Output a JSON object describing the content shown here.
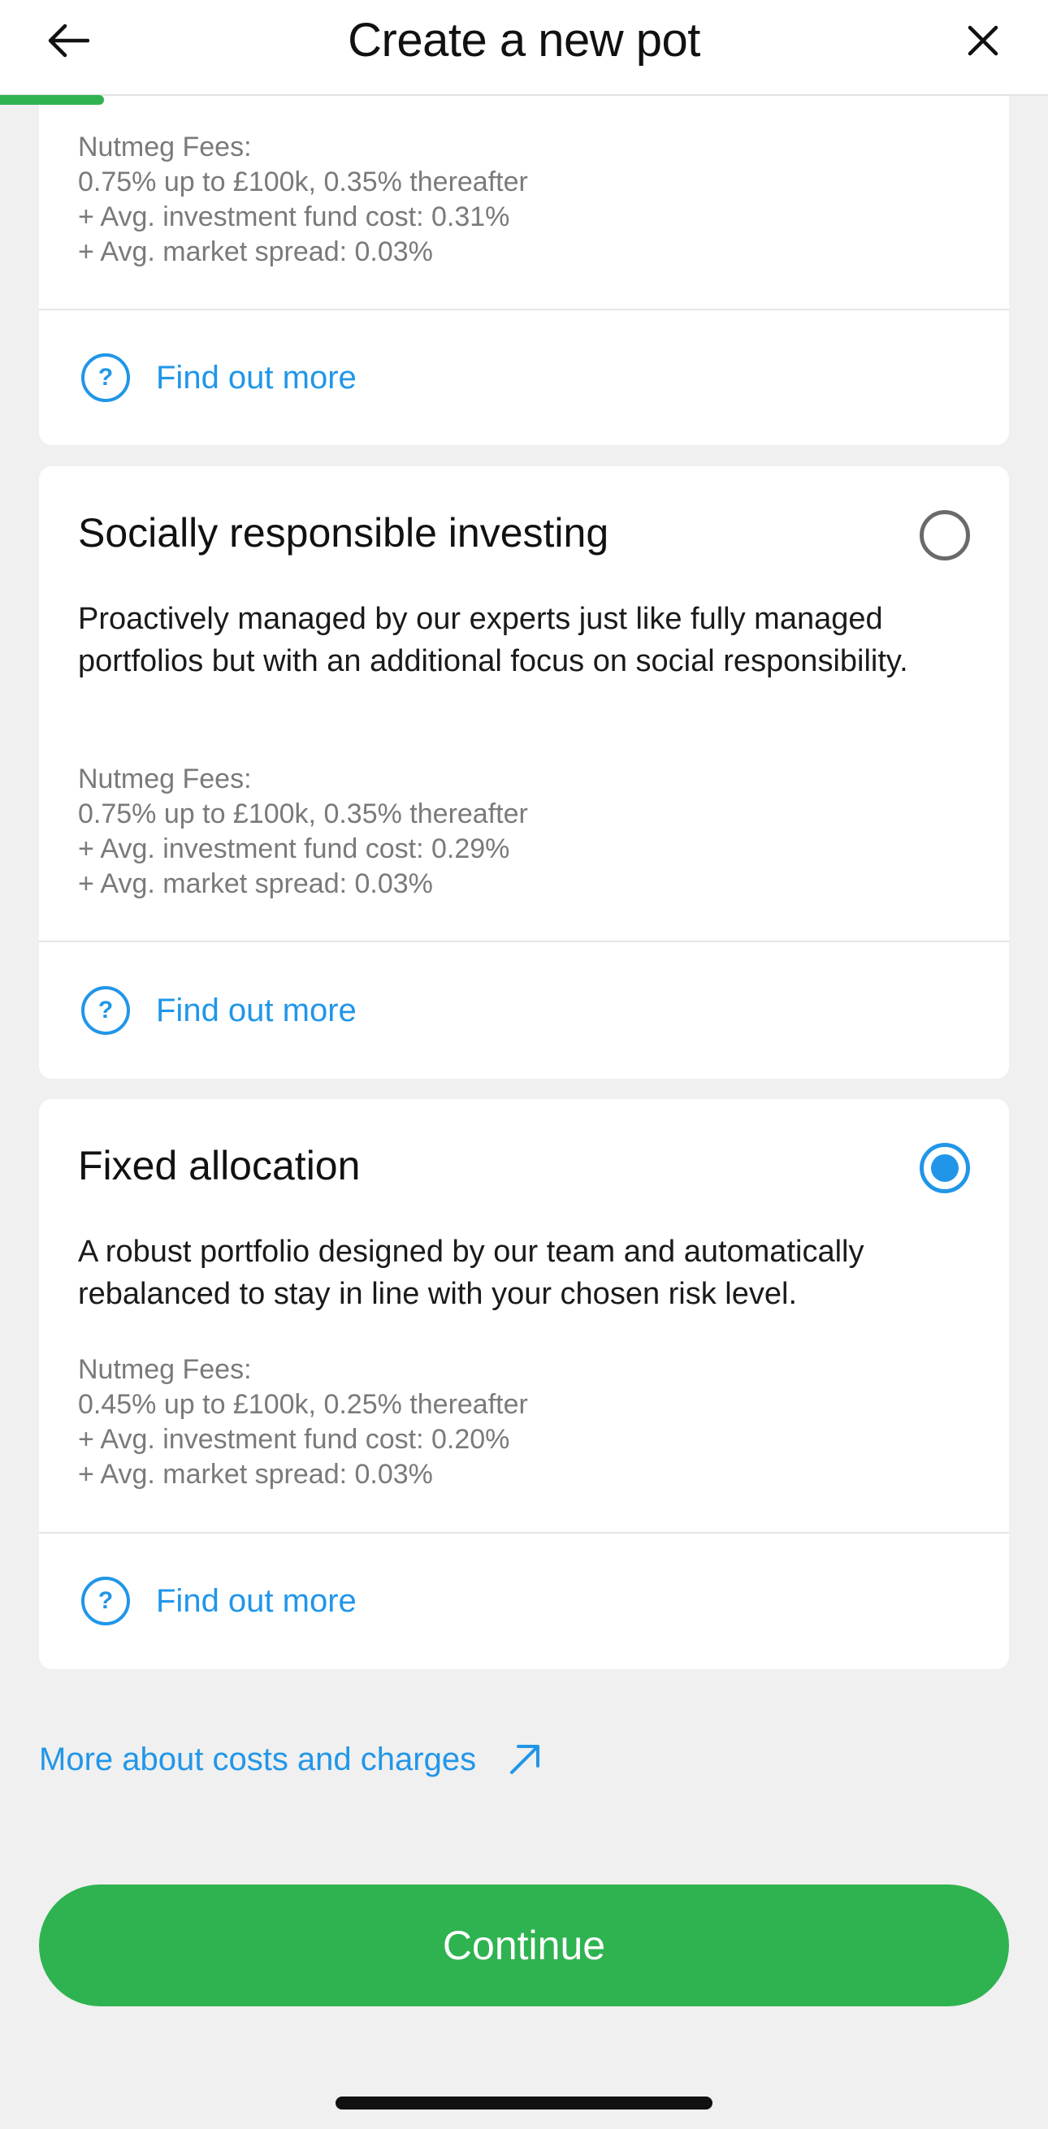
{
  "header": {
    "title": "Create a new pot",
    "back_icon": "arrow-left-icon",
    "close_icon": "close-icon"
  },
  "progress": {
    "percent": 10
  },
  "cards": [
    {
      "title": "",
      "description": "",
      "fees": [
        "Nutmeg Fees:",
        "0.75% up to £100k, 0.35% thereafter",
        "+ Avg. investment fund cost: 0.31%",
        "+ Avg. market spread: 0.03%"
      ],
      "find_more": "Find out more",
      "selected": false
    },
    {
      "title": "Socially responsible investing",
      "description": "Proactively managed by our experts just like fully managed portfolios but with an additional focus on social responsibility.",
      "fees": [
        "Nutmeg Fees:",
        "0.75% up to £100k, 0.35% thereafter",
        "+ Avg. investment fund cost: 0.29%",
        "+ Avg. market spread: 0.03%"
      ],
      "find_more": "Find out more",
      "selected": false
    },
    {
      "title": "Fixed allocation",
      "description": "A robust portfolio designed by our team and automatically rebalanced to stay in line with your chosen risk level.",
      "fees": [
        "Nutmeg Fees:",
        "0.45% up to £100k, 0.25% thereafter",
        "+ Avg. investment fund cost: 0.20%",
        "+ Avg. market spread: 0.03%"
      ],
      "find_more": "Find out more",
      "selected": true
    }
  ],
  "costs_link": {
    "label": "More about costs and charges",
    "icon": "external-arrow-icon"
  },
  "continue_button": {
    "label": "Continue"
  },
  "colors": {
    "accent_blue": "#2196e8",
    "brand_green": "#2fb351",
    "background": "#f0f0f0"
  }
}
